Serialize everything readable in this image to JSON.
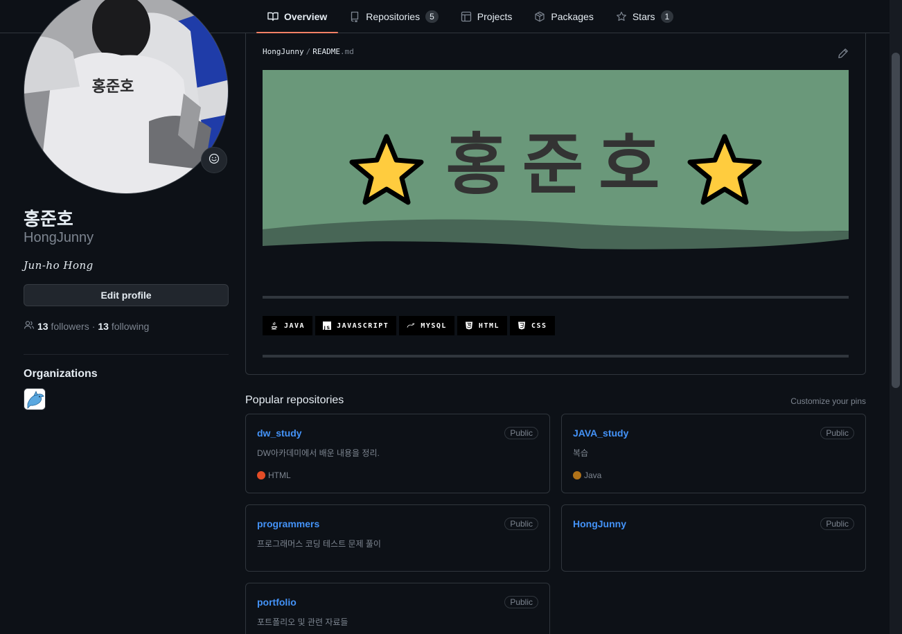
{
  "tabs": [
    {
      "label": "Overview",
      "icon": "book-icon",
      "active": true
    },
    {
      "label": "Repositories",
      "icon": "repo-icon",
      "count": "5"
    },
    {
      "label": "Projects",
      "icon": "table-icon"
    },
    {
      "label": "Packages",
      "icon": "package-icon"
    },
    {
      "label": "Stars",
      "icon": "star-icon",
      "count": "1"
    }
  ],
  "profile": {
    "full_name": "홍준호",
    "login": "HongJunny",
    "bio": "Jun-ho Hong",
    "edit_profile_label": "Edit profile",
    "followers_count": "13",
    "followers_label": "followers",
    "separator": "·",
    "following_count": "13",
    "following_label": "following",
    "avatar_jersey_text": "홍준호",
    "organizations_title": "Organizations"
  },
  "readme": {
    "owner": "HongJunny",
    "separator": "/",
    "file_base": "README",
    "file_ext": ".md",
    "banner_text": "홍준호",
    "banner_colors": {
      "bg": "#6a987a",
      "wave": "#486656",
      "text": "#333333",
      "star": "#ffcc3e"
    },
    "badges": [
      {
        "label": "JAVA",
        "icon": "java-icon"
      },
      {
        "label": "JAVASCRIPT",
        "icon": "javascript-icon"
      },
      {
        "label": "MYSQL",
        "icon": "mysql-icon"
      },
      {
        "label": "HTML",
        "icon": "html5-icon"
      },
      {
        "label": "CSS",
        "icon": "css3-icon"
      }
    ]
  },
  "popular": {
    "title": "Popular repositories",
    "customize_label": "Customize your pins",
    "repos": [
      {
        "name": "dw_study",
        "visibility": "Public",
        "description": "DW아카데미에서 배운 내용을 정리.",
        "language": "HTML",
        "language_color": "#e34c26"
      },
      {
        "name": "JAVA_study",
        "visibility": "Public",
        "description": "복습",
        "language": "Java",
        "language_color": "#b07219"
      },
      {
        "name": "programmers",
        "visibility": "Public",
        "description": "프로그래머스 코딩 테스트 문제 풀이",
        "language": "",
        "language_color": ""
      },
      {
        "name": "HongJunny",
        "visibility": "Public",
        "description": "",
        "language": "",
        "language_color": ""
      },
      {
        "name": "portfolio",
        "visibility": "Public",
        "description": "포트폴리오 및 관련 자료들",
        "language": "",
        "language_color": ""
      }
    ]
  },
  "colors": {
    "background": "#0d1117",
    "border": "#30363d",
    "link": "#4493f8",
    "muted": "#7d8590",
    "tab_underline": "#f78166"
  }
}
